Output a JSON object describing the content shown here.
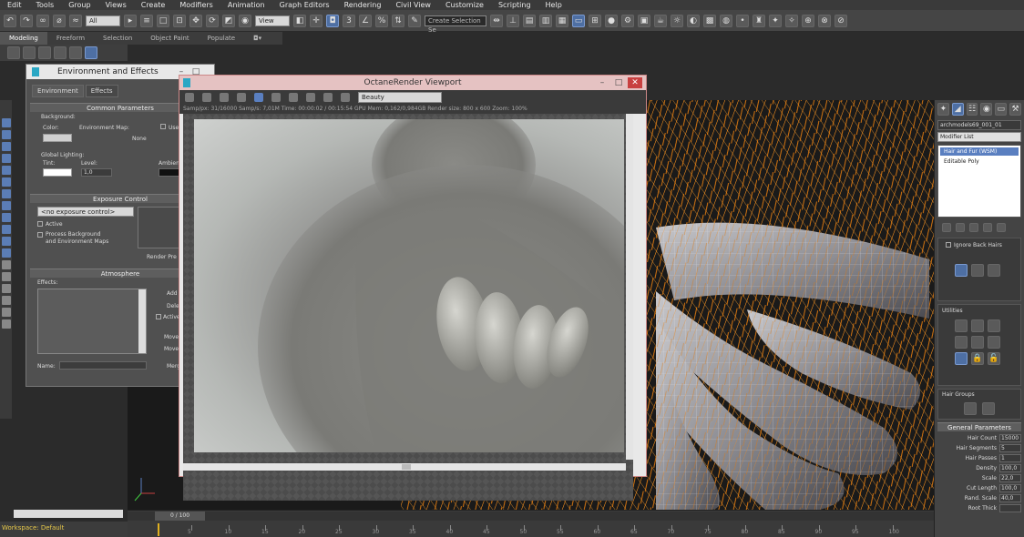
{
  "menu": [
    "Edit",
    "Tools",
    "Group",
    "Views",
    "Create",
    "Modifiers",
    "Animation",
    "Graph Editors",
    "Rendering",
    "Civil View",
    "Customize",
    "Scripting",
    "Help"
  ],
  "toolbar": {
    "filter_dropdown": "All",
    "view_dropdown": "View",
    "selection_set": "Create Selection Se"
  },
  "ribbon": {
    "tabs": [
      "Modeling",
      "Freeform",
      "Selection",
      "Object Paint",
      "Populate"
    ],
    "active": "Modeling"
  },
  "env_window": {
    "title": "Environment and Effects",
    "tabs": [
      "Environment",
      "Effects"
    ],
    "common_params": "Common Parameters",
    "background": "Background:",
    "color": "Color:",
    "env_map": "Environment Map:",
    "use_map": "Use",
    "none": "None",
    "global_lighting": "Global Lighting:",
    "tint": "Tint:",
    "level": "Level:",
    "level_value": "1,0",
    "ambient": "Ambient",
    "exposure_control": "Exposure Control",
    "exposure_dropdown": "<no exposure control>",
    "active": "Active",
    "process_bg_1": "Process Background",
    "process_bg_2": "and Environment Maps",
    "render_preview": "Render Pre",
    "atmosphere": "Atmosphere",
    "effects": "Effects:",
    "add": "Add",
    "delete": "Dele",
    "active2": "Active",
    "move_up": "Move",
    "move_down": "Move",
    "name": "Name:",
    "merge": "Merg"
  },
  "octane": {
    "title": "OctaneRender Viewport",
    "pass_dropdown": "Beauty",
    "status": "Samp/px: 31/16000   Samp/s: 7,01M   Time: 00:00:02 / 00:15:54   GPU Mem: 0,162/0,984GB   Render size: 800 x 600   Zoom: 100%"
  },
  "right_panel": {
    "object_name": "archmodels69_001_01",
    "modifier_list": "Modifier List",
    "modifiers": [
      "Hair and Fur (WSM)",
      "Editable Poly"
    ],
    "ignore_back_hairs": "Ignore Back Hairs",
    "utilities": "Utilities",
    "hair_groups": "Hair Groups",
    "general_params": "General Parameters",
    "params": [
      {
        "label": "Hair Count",
        "value": "15000"
      },
      {
        "label": "Hair Segments",
        "value": "5"
      },
      {
        "label": "Hair Passes",
        "value": "1"
      },
      {
        "label": "Density",
        "value": "100,0"
      },
      {
        "label": "Scale",
        "value": "22,0"
      },
      {
        "label": "Cut Length",
        "value": "100,0"
      },
      {
        "label": "Rand. Scale",
        "value": "40,0"
      },
      {
        "label": "Root Thick",
        "value": ""
      }
    ]
  },
  "status": {
    "workspace": "Workspace: Default",
    "frame": "0 / 100"
  },
  "timeline_ticks": [
    "5",
    "10",
    "15",
    "20",
    "25",
    "30",
    "35",
    "40",
    "45",
    "50",
    "55",
    "60",
    "65",
    "70",
    "75",
    "80",
    "85",
    "90",
    "95",
    "100"
  ],
  "colors": {
    "hair": "#f08c1e",
    "accent": "#5a7fc0",
    "close": "#c84040"
  }
}
